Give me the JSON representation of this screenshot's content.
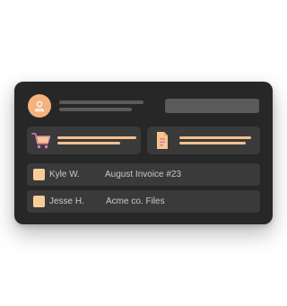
{
  "colors": {
    "card_bg": "#272727",
    "tile_bg": "#3a3a3a",
    "accent": "#f4b27e",
    "accent_line": "#f5c08d",
    "placeholder": "#5a5a5a",
    "text": "#c9c9c9"
  },
  "header": {
    "avatar_icon": "user-icon",
    "search_placeholder": ""
  },
  "tiles": [
    {
      "icon": "shopping-cart-icon"
    },
    {
      "icon": "document-icon"
    }
  ],
  "rows": [
    {
      "name": "Kyle W.",
      "title": "August Invoice #23"
    },
    {
      "name": "Jesse H.",
      "title": "Acme co. Files"
    }
  ]
}
